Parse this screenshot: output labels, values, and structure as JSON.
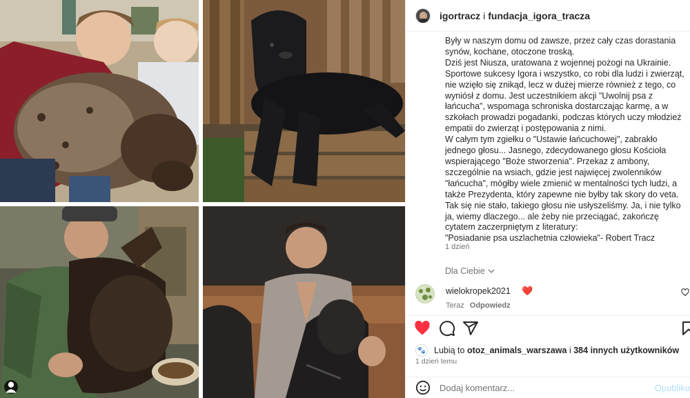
{
  "post": {
    "author": "igortracz",
    "joiner": "i",
    "coauthor": "fundacja_igora_tracza",
    "caption_lines": [
      "Były w naszym domu od zawsze, przez cały czas dorastania synów, kochane, otoczone troską.",
      "Dziś jest Niusza, uratowana z wojennej pożogi na Ukrainie.",
      "Sportowe sukcesy Igora i wszystko, co robi dla ludzi i zwierząt, nie wzięło się znikąd, lecz w dużej mierze również z tego, co wyniósł z domu. Jest uczestnikiem akcji \"Uwolnij psa z łańcucha\", wspomaga schroniska dostarczając karmę, a w szkołach prowadzi pogadanki, podczas których uczy młodzież empatii do zwierząt i postępowania z nimi.",
      "W całym tym zgiełku o \"Ustawie łańcuchowej\", zabrakło jednego głosu... Jasnego, zdecydowanego głosu Kościoła wspierającego \"Boże stworzenia\". Przekaz z ambony, szczególnie na wsiach, gdzie jest najwięcej zwolenników \"łańcucha\", mógłby wiele zmienić w mentalności tych ludzi, a także Prezydenta, który zapewne nie byłby tak skory do veta.",
      "Tak się nie stało, takiego głosu nie usłyszeliśmy. Ja, i nie tylko ja, wiemy dlaczego... ale żeby nie przeciągać, zakończę cytatem zaczerpniętym z literatury:",
      "\"Posiadanie psa uszlachetnia człowieka\"- Robert Tracz"
    ],
    "caption_time": "1 dzień",
    "see_translation": "Dla Ciebie"
  },
  "comment": {
    "username": "wielokropek2021",
    "emoji": "❤️",
    "time": "Teraz",
    "reply_label": "Odpowiedz",
    "like_icon": "heart-outline-icon"
  },
  "likes": {
    "prefix": "Lubią to",
    "first_user": "otoz_animals_warszawa",
    "joiner": "i",
    "others": "384 innych użytkowników"
  },
  "post_date": "1 dzień temu",
  "add_comment": {
    "placeholder": "Dodaj komentarz...",
    "publish_label": "Opublikuj"
  },
  "colors": {
    "like_red": "#ff3040",
    "link_blue": "#0095f6",
    "publish_disabled": "#b2dffc",
    "muted_text": "#737373"
  }
}
